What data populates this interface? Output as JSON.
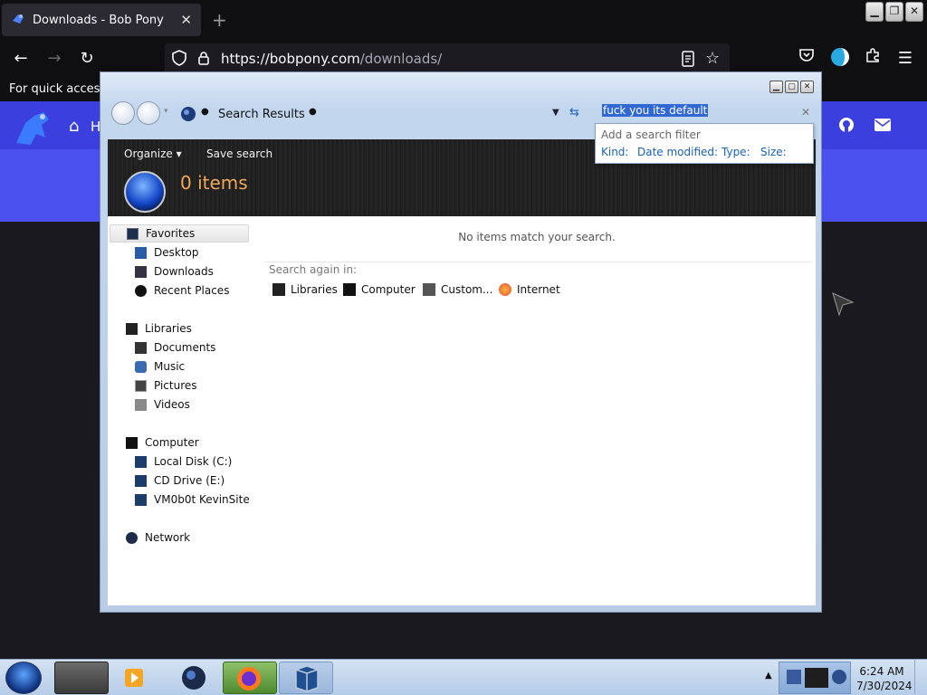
{
  "browser": {
    "tab_title": "Downloads - Bob Pony",
    "url_host": "https://bobpony.com",
    "url_path": "/downloads/",
    "bookmarks_text": "For quick access, p",
    "site_home_partial": "H"
  },
  "explorer": {
    "breadcrumb": "Search Results",
    "search_query": "fuck you its default",
    "filter": {
      "title": "Add a search filter",
      "items": [
        "Kind:",
        "Date modified:",
        "Type:",
        "Size:"
      ]
    },
    "toolbar": {
      "organize": "Organize",
      "save_search": "Save search"
    },
    "items_count": "0 items",
    "navpane": {
      "favorites": "Favorites",
      "desktop": "Desktop",
      "downloads": "Downloads",
      "recent": "Recent Places",
      "libraries": "Libraries",
      "documents": "Documents",
      "music": "Music",
      "pictures": "Pictures",
      "videos": "Videos",
      "computer": "Computer",
      "local_disk": "Local Disk (C:)",
      "cd_drive": "CD Drive (E:)",
      "network_share": "VM0b0t KevinSite",
      "network": "Network"
    },
    "results": {
      "empty_message": "No items match your search.",
      "search_again_label": "Search again in:",
      "locations": [
        "Libraries",
        "Computer",
        "Custom...",
        "Internet"
      ]
    }
  },
  "taskbar": {
    "time": "6:24 AM",
    "date": "7/30/2024"
  },
  "colors": {
    "browser_bg": "#0f0f12",
    "site_accent": "#4a50ee",
    "items_count_orange": "#f0a75a",
    "search_highlight": "#3168d3"
  }
}
